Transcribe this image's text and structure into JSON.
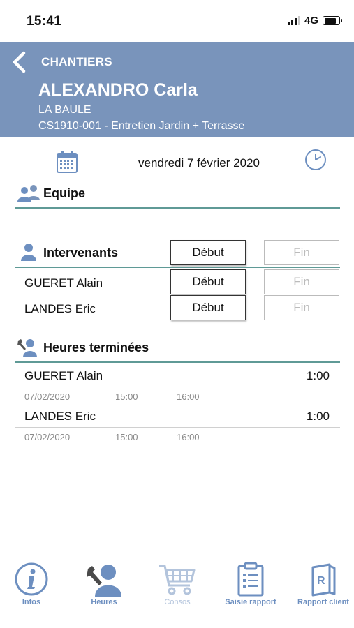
{
  "status": {
    "time": "15:41",
    "network": "4G"
  },
  "header": {
    "back_label": "CHANTIERS",
    "client_name": "ALEXANDRO Carla",
    "city": "LA BAULE",
    "site": "CS1910-001 - Entretien Jardin + Terrasse"
  },
  "date": {
    "label": "vendredi 7 février 2020"
  },
  "equipe": {
    "title": "Equipe"
  },
  "intervenants": {
    "title": "Intervenants",
    "start_label": "Début",
    "end_label": "Fin",
    "rows": [
      {
        "name": "GUERET Alain",
        "start_label": "Début",
        "end_label": "Fin"
      },
      {
        "name": "LANDES Eric",
        "start_label": "Début",
        "end_label": "Fin"
      }
    ]
  },
  "heures_terminees": {
    "title": "Heures terminées",
    "rows": [
      {
        "name": "GUERET Alain",
        "total": "1:00",
        "date": "07/02/2020",
        "start": "15:00",
        "end": "16:00"
      },
      {
        "name": "LANDES Eric",
        "total": "1:00",
        "date": "07/02/2020",
        "start": "15:00",
        "end": "16:00"
      }
    ]
  },
  "tabs": [
    {
      "label": "Infos",
      "icon": "info-icon",
      "active": true
    },
    {
      "label": "Heures",
      "icon": "worker-wrench-icon",
      "active": true
    },
    {
      "label": "Consos",
      "icon": "cart-icon",
      "active": false
    },
    {
      "label": "Saisie rapport",
      "icon": "clipboard-icon",
      "active": true
    },
    {
      "label": "Rapport client",
      "icon": "report-book-icon",
      "active": true
    }
  ],
  "colors": {
    "header_bg": "#7994bb",
    "accent": "#6d8fc0",
    "divider": "#5f9a96"
  }
}
